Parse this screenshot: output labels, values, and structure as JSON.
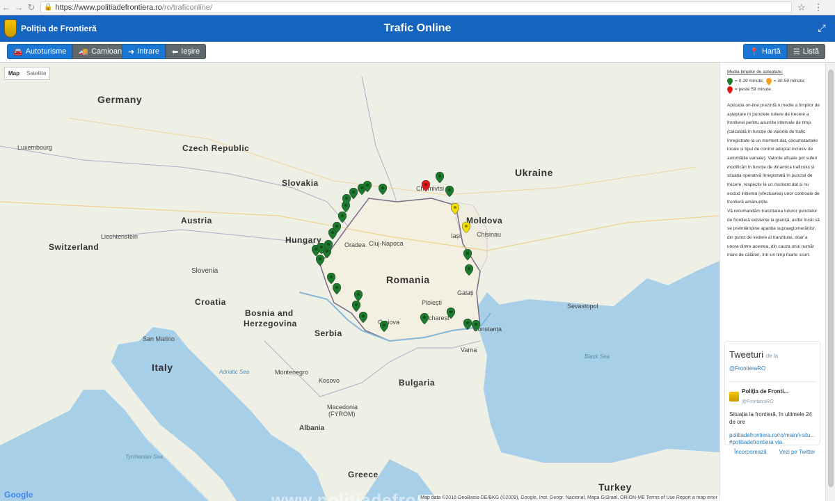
{
  "browser": {
    "url_host": "https://www.politiadefrontiera.ro",
    "url_path": "/ro/traficonline/"
  },
  "header": {
    "brand": "Poliția de Frontieră",
    "title": "Trafic Online"
  },
  "toolbar": {
    "cars": "Autoturisme",
    "trucks": "Camioane",
    "entry": "Intrare",
    "exit": "Ieșire",
    "map": "Hartă",
    "list": "Listă"
  },
  "map": {
    "type_map": "Map",
    "type_satellite": "Satellite",
    "countries": {
      "germany": "Germany",
      "czech": "Czech Republic",
      "slovakia": "Slovakia",
      "austria": "Austria",
      "hungary": "Hungary",
      "switzerland": "Switzerland",
      "liechtenstein": "Liechtenstein",
      "slovenia": "Slovenia",
      "croatia": "Croatia",
      "bosnia": "Bosnia and",
      "herzegovina": "Herzegovina",
      "serbia": "Serbia",
      "italy": "Italy",
      "romania": "Romania",
      "bulgaria": "Bulgaria",
      "ukraine": "Ukraine",
      "moldova": "Moldova",
      "greece": "Greece",
      "turkey": "Turkey",
      "albania": "Albania",
      "macedonia": "Macedonia",
      "fyrom": "(FYROM)",
      "montenegro": "Montenegro",
      "kosovo": "Kosovo",
      "san_marino": "San Marino",
      "luxembourg": "Luxembourg"
    },
    "cities": {
      "cluj": "Cluj-Napoca",
      "oradea": "Oradea",
      "bucharest": "Bucharest",
      "craiova": "Craiova",
      "galati": "Galați",
      "constanta": "Constanța",
      "varna": "Varna",
      "iasi": "Iași",
      "chisinau": "Chisinau",
      "chernivtsi": "Chernivtsi",
      "ploiesti": "Ploiești",
      "sevastopol": "Sevastopol"
    },
    "seas": {
      "black_sea": "Black Sea",
      "adriatic": "Adriatic Sea",
      "tyrrhenian": "Tyrrhenian Sea"
    },
    "watermark": "www.politiadefrontiera.ro",
    "google": "Google",
    "attribution": "Map data ©2016 GeoBasis-DE/BKG (©2009), Google, Inst. Geogr. Nacional, Mapa GISrael, ORION-ME  Terms of Use  Report a map error"
  },
  "panel": {
    "legend_title": "Media timpilor de așteptare:",
    "legend_green": "= 0-29 minute;",
    "legend_orange": "= 30-59 minute;",
    "legend_red": "= peste 59 minute.",
    "desc1": "Aplicația on-line prezintă o medie a timpilor de așteptare în punctele rutiere de trecere a frontierei pentru anumite intervale de timp (calculată în funcție de valorile de trafic înregistrate la un moment dat, circumstanțele locale și tipul de control adoptat inclusiv de autoritățile vamale). Valorile afișate pot suferi modificări în funcție de dinamica traficului și situația operativă înregistrată în punctul de trecere, respectiv la un moment dat și nu exclud inițierea (efectuarea) unor controale de frontieră amănunțite.",
    "desc2": "Vă recomandăm tranzitarea tuturor punctelor de frontieră existente la graniță, astfel încât să se preîntâmpine apariția supraaglomerărilor, din punct de vedere al tranzitului, doar a unora dintre acestea, din cauza unui număr mare de călători, într-un timp foarte scurt.",
    "tweets_title": "Tweeturi",
    "tweets_by": "de la",
    "tweets_handle": "@FrontieraRO",
    "tweet_author": "Poliția de Fronti...",
    "tweet_user": "@FrontieraRO",
    "tweet_text": "Situația la frontieră, în ultimele 24 de ore",
    "tweet_link": "politiadefrontiera.ro/ro/main/i-situ... #politiadefrontiera",
    "tweet_via": "via",
    "embed": "Încorporează",
    "view_twitter": "Vezi pe Twitter"
  },
  "colors": {
    "header_blue": "#1565c0",
    "pin_green": "#1b7a2b",
    "pin_yellow": "#f4e000",
    "pin_red": "#e01616"
  }
}
